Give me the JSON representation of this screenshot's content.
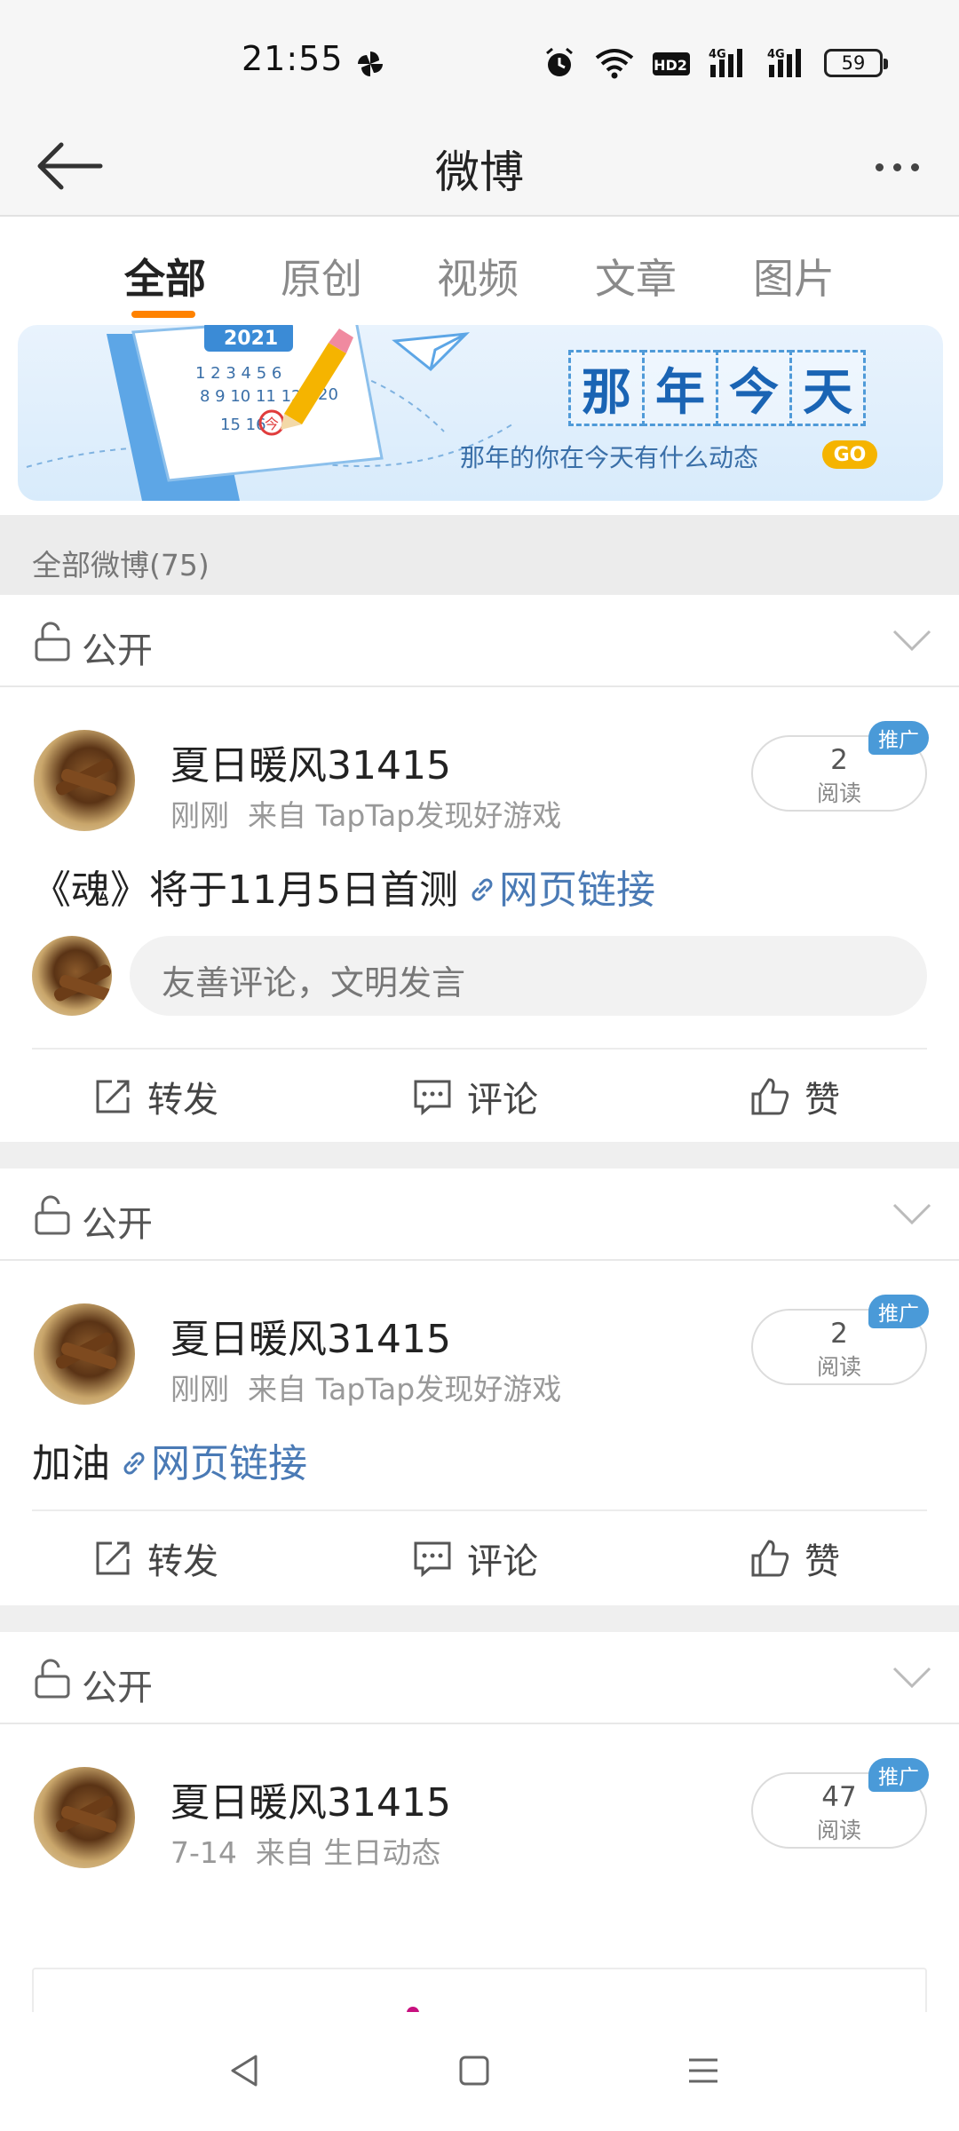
{
  "status_bar": {
    "time": "21:55",
    "icons": [
      "alarm-icon",
      "wifi-icon",
      "hd-icon",
      "signal-4g-icon",
      "signal-4g-icon"
    ],
    "hd_label": "HD2",
    "net1": "4G",
    "net2": "4G",
    "battery": "59"
  },
  "header": {
    "title": "微博",
    "back_icon": "back-arrow-icon",
    "more_icon": "more-dots-icon"
  },
  "tabs": [
    {
      "label": "全部",
      "active": true
    },
    {
      "label": "原创",
      "active": false
    },
    {
      "label": "视频",
      "active": false
    },
    {
      "label": "文章",
      "active": false
    },
    {
      "label": "图片",
      "active": false
    }
  ],
  "banner": {
    "calendar_year": "2021",
    "calendar_mark": "今",
    "chars": [
      "那",
      "年",
      "今",
      "天"
    ],
    "subtitle": "那年的你在今天有什么动态",
    "go_label": "GO"
  },
  "count_label": "全部微博(75)",
  "privacy_label": "公开",
  "posts": [
    {
      "user": "夏日暖风31415",
      "time": "刚刚",
      "source": "来自 TapTap发现好游戏",
      "reads": "2",
      "reads_label": "阅读",
      "promo_label": "推广",
      "text": "《魂》将于11月5日首测",
      "link_text": "网页链接",
      "comment_placeholder": "友善评论，文明发言"
    },
    {
      "user": "夏日暖风31415",
      "time": "刚刚",
      "source": "来自 TapTap发现好游戏",
      "reads": "2",
      "reads_label": "阅读",
      "promo_label": "推广",
      "text": "加油",
      "link_text": "网页链接"
    },
    {
      "user": "夏日暖风31415",
      "time": "7-14",
      "source": "来自 生日动态",
      "reads": "47",
      "reads_label": "阅读",
      "promo_label": "推广"
    }
  ],
  "actions": {
    "repost": "转发",
    "comment": "评论",
    "like": "赞"
  },
  "colors": {
    "accent": "#ff8200",
    "link": "#4a7ab5",
    "promo": "#4a9ad8"
  }
}
